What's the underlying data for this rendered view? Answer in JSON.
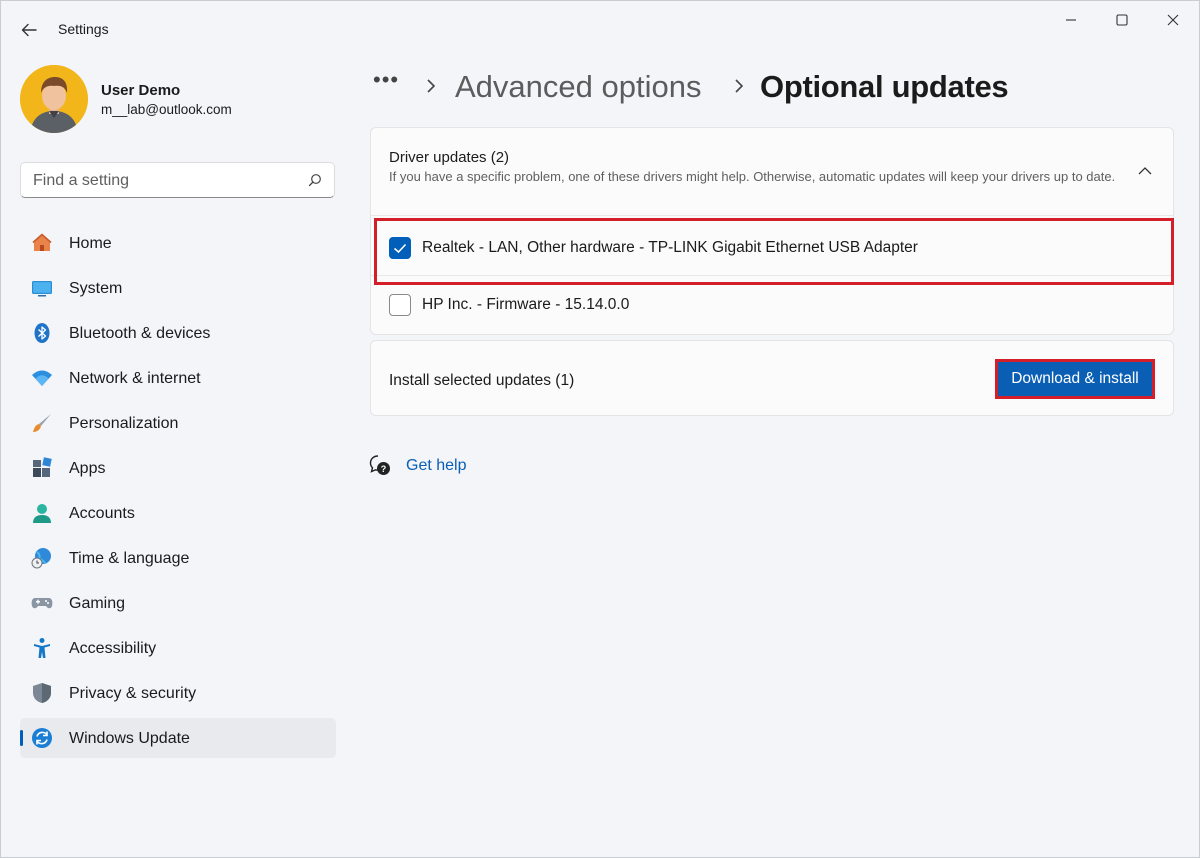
{
  "app": {
    "title": "Settings",
    "back_icon": "back-arrow-icon",
    "controls": [
      "minimize-icon",
      "maximize-icon",
      "close-icon"
    ]
  },
  "profile": {
    "name": "User Demo",
    "email": "m__lab@outlook.com"
  },
  "search": {
    "placeholder": "Find a setting",
    "icon": "search-icon"
  },
  "sidebar": {
    "items": [
      {
        "label": "Home",
        "icon": "home-icon",
        "active": false
      },
      {
        "label": "System",
        "icon": "system-icon",
        "active": false
      },
      {
        "label": "Bluetooth & devices",
        "icon": "bluetooth-icon",
        "active": false
      },
      {
        "label": "Network & internet",
        "icon": "wifi-icon",
        "active": false
      },
      {
        "label": "Personalization",
        "icon": "brush-icon",
        "active": false
      },
      {
        "label": "Apps",
        "icon": "apps-icon",
        "active": false
      },
      {
        "label": "Accounts",
        "icon": "accounts-icon",
        "active": false
      },
      {
        "label": "Time & language",
        "icon": "globe-clock-icon",
        "active": false
      },
      {
        "label": "Gaming",
        "icon": "gamepad-icon",
        "active": false
      },
      {
        "label": "Accessibility",
        "icon": "accessibility-icon",
        "active": false
      },
      {
        "label": "Privacy & security",
        "icon": "shield-icon",
        "active": false
      },
      {
        "label": "Windows Update",
        "icon": "windows-update-icon",
        "active": true
      }
    ]
  },
  "breadcrumb": {
    "more": "•••",
    "parent": "Advanced options",
    "current": "Optional updates"
  },
  "drivers": {
    "title": "Driver updates (2)",
    "description": "If you have a specific problem, one of these drivers might help. Otherwise, automatic updates will keep your drivers up to date.",
    "items": [
      {
        "label": "Realtek - LAN, Other hardware - TP-LINK Gigabit Ethernet USB Adapter",
        "checked": true
      },
      {
        "label": "HP Inc. - Firmware - 15.14.0.0",
        "checked": false
      }
    ]
  },
  "install": {
    "label": "Install selected updates (1)",
    "button": "Download & install"
  },
  "help": {
    "label": "Get help",
    "icon": "help-chat-icon"
  },
  "colors": {
    "accent": "#005fb8",
    "highlight": "#d41e2a"
  }
}
